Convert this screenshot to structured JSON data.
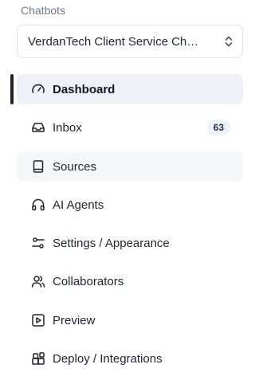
{
  "section": {
    "label": "Chatbots"
  },
  "selector": {
    "value": "VerdanTech Client Service Ch…"
  },
  "nav": {
    "items": [
      {
        "label": "Dashboard",
        "icon": "gauge-icon",
        "active": true
      },
      {
        "label": "Inbox",
        "icon": "inbox-icon",
        "badge": "63"
      },
      {
        "label": "Sources",
        "icon": "book-icon",
        "hover": true
      },
      {
        "label": "AI Agents",
        "icon": "headphones-icon"
      },
      {
        "label": "Settings / Appearance",
        "icon": "sliders-icon"
      },
      {
        "label": "Collaborators",
        "icon": "users-icon"
      },
      {
        "label": "Preview",
        "icon": "play-square-icon"
      },
      {
        "label": "Deploy / Integrations",
        "icon": "blocks-icon"
      }
    ]
  }
}
